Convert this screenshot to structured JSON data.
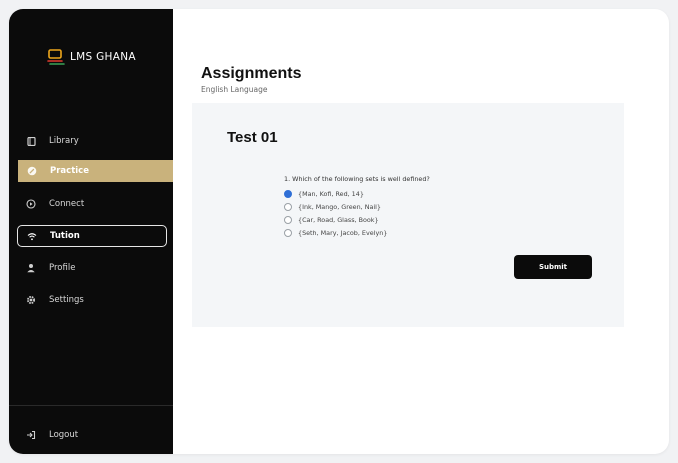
{
  "sidebar": {
    "logo_text": "LMS GHANA",
    "items": [
      {
        "label": "Library",
        "icon": "book-icon",
        "state": "normal"
      },
      {
        "label": "Practice",
        "icon": "edit-icon",
        "state": "active"
      },
      {
        "label": "Connect",
        "icon": "play-icon",
        "state": "normal"
      },
      {
        "label": "Tution",
        "icon": "wifi-icon",
        "state": "outlined"
      },
      {
        "label": "Profile",
        "icon": "user-icon",
        "state": "normal"
      },
      {
        "label": "Settings",
        "icon": "gear-icon",
        "state": "normal"
      }
    ],
    "logout_label": "Logout",
    "logout_icon": "logout-icon"
  },
  "main": {
    "title": "Assignments",
    "subtitle": "English Language"
  },
  "test": {
    "title": "Test 01",
    "question": "1.  Which of the following sets is well defined?",
    "options": [
      {
        "label": "{Man, Kofi, Red, 14}",
        "selected": true
      },
      {
        "label": "{Ink, Mango, Green, Nail}",
        "selected": false
      },
      {
        "label": "{Car, Road, Glass, Book}",
        "selected": false
      },
      {
        "label": "{Seth, Mary, Jacob, Evelyn}",
        "selected": false
      }
    ],
    "submit_label": "Submit"
  },
  "colors": {
    "sidebar_bg": "#0b0b0b",
    "accent_gold": "#c9b27c",
    "radio_selected": "#2f6fd6",
    "panel_bg": "#f4f6f8"
  }
}
